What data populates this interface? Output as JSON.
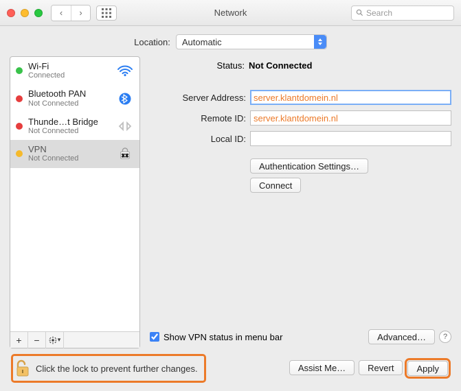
{
  "window": {
    "title": "Network",
    "search_placeholder": "Search"
  },
  "location": {
    "label": "Location:",
    "value": "Automatic"
  },
  "sidebar": {
    "items": [
      {
        "name": "Wi-Fi",
        "status": "Connected",
        "dot": "green"
      },
      {
        "name": "Bluetooth PAN",
        "status": "Not Connected",
        "dot": "red"
      },
      {
        "name": "Thunde…t Bridge",
        "status": "Not Connected",
        "dot": "red"
      },
      {
        "name": "VPN",
        "status": "Not Connected",
        "dot": "yellow"
      }
    ],
    "selected_index": 3,
    "add": "+",
    "remove": "−",
    "gear": "✻"
  },
  "main": {
    "status_label": "Status:",
    "status_value": "Not Connected",
    "server_label": "Server Address:",
    "server_value": "server.klantdomein.nl",
    "remote_label": "Remote ID:",
    "remote_value": "server.klantdomein.nl",
    "local_label": "Local ID:",
    "local_value": "",
    "auth_btn": "Authentication Settings…",
    "connect_btn": "Connect",
    "show_checkbox": "Show VPN status in menu bar",
    "show_checked": true,
    "advanced_btn": "Advanced…",
    "help": "?"
  },
  "footer": {
    "lock_msg": "Click the lock to prevent further changes.",
    "assist": "Assist Me…",
    "revert": "Revert",
    "apply": "Apply"
  }
}
